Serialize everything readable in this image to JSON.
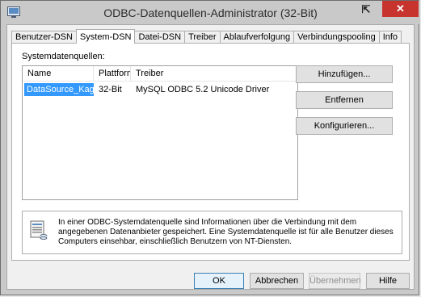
{
  "window": {
    "title": "ODBC-Datenquellen-Administrator (32-Bit)",
    "help_glyph": "⇱",
    "close_glyph": "✕",
    "icons": {
      "app": "odbc-admin-icon",
      "close": "close-icon",
      "help": "help-icon"
    }
  },
  "tabs": [
    {
      "label": "Benutzer-DSN",
      "active": false
    },
    {
      "label": "System-DSN",
      "active": true
    },
    {
      "label": "Datei-DSN",
      "active": false
    },
    {
      "label": "Treiber",
      "active": false
    },
    {
      "label": "Ablaufverfolgung",
      "active": false
    },
    {
      "label": "Verbindungspooling",
      "active": false
    },
    {
      "label": "Info",
      "active": false
    }
  ],
  "panel": {
    "group_label": "Systemdatenquellen:",
    "columns": [
      "Name",
      "Plattform",
      "Treiber"
    ],
    "rows": [
      {
        "name": "DataSource_Kaggle",
        "platform": "32-Bit",
        "driver": "MySQL ODBC 5.2 Unicode Driver",
        "selected": true
      }
    ],
    "buttons": {
      "add": "Hinzufügen...",
      "remove": "Entfernen",
      "configure": "Konfigurieren..."
    },
    "info_text": "In einer ODBC-Systemdatenquelle sind Informationen über die Verbindung mit dem angegebenen Datenanbieter gespeichert. Eine Systemdatenquelle ist für alle Benutzer dieses Computers einsehbar, einschließlich Benutzern von NT-Diensten."
  },
  "footer": {
    "ok": "OK",
    "cancel": "Abbrechen",
    "apply": "Übernehmen",
    "help": "Hilfe"
  },
  "colors": {
    "selection": "#3399ff",
    "close": "#c7342e",
    "titlebar": "#c9c9c9"
  }
}
